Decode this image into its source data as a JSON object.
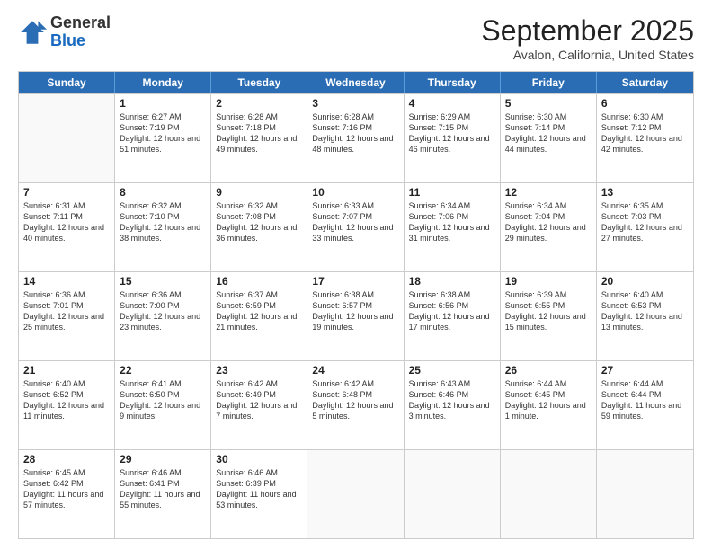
{
  "header": {
    "logo_general": "General",
    "logo_blue": "Blue",
    "month_title": "September 2025",
    "location": "Avalon, California, United States"
  },
  "weekdays": [
    "Sunday",
    "Monday",
    "Tuesday",
    "Wednesday",
    "Thursday",
    "Friday",
    "Saturday"
  ],
  "weeks": [
    [
      {
        "day": "",
        "empty": true
      },
      {
        "day": "1",
        "sunrise": "Sunrise: 6:27 AM",
        "sunset": "Sunset: 7:19 PM",
        "daylight": "Daylight: 12 hours and 51 minutes."
      },
      {
        "day": "2",
        "sunrise": "Sunrise: 6:28 AM",
        "sunset": "Sunset: 7:18 PM",
        "daylight": "Daylight: 12 hours and 49 minutes."
      },
      {
        "day": "3",
        "sunrise": "Sunrise: 6:28 AM",
        "sunset": "Sunset: 7:16 PM",
        "daylight": "Daylight: 12 hours and 48 minutes."
      },
      {
        "day": "4",
        "sunrise": "Sunrise: 6:29 AM",
        "sunset": "Sunset: 7:15 PM",
        "daylight": "Daylight: 12 hours and 46 minutes."
      },
      {
        "day": "5",
        "sunrise": "Sunrise: 6:30 AM",
        "sunset": "Sunset: 7:14 PM",
        "daylight": "Daylight: 12 hours and 44 minutes."
      },
      {
        "day": "6",
        "sunrise": "Sunrise: 6:30 AM",
        "sunset": "Sunset: 7:12 PM",
        "daylight": "Daylight: 12 hours and 42 minutes."
      }
    ],
    [
      {
        "day": "7",
        "sunrise": "Sunrise: 6:31 AM",
        "sunset": "Sunset: 7:11 PM",
        "daylight": "Daylight: 12 hours and 40 minutes."
      },
      {
        "day": "8",
        "sunrise": "Sunrise: 6:32 AM",
        "sunset": "Sunset: 7:10 PM",
        "daylight": "Daylight: 12 hours and 38 minutes."
      },
      {
        "day": "9",
        "sunrise": "Sunrise: 6:32 AM",
        "sunset": "Sunset: 7:08 PM",
        "daylight": "Daylight: 12 hours and 36 minutes."
      },
      {
        "day": "10",
        "sunrise": "Sunrise: 6:33 AM",
        "sunset": "Sunset: 7:07 PM",
        "daylight": "Daylight: 12 hours and 33 minutes."
      },
      {
        "day": "11",
        "sunrise": "Sunrise: 6:34 AM",
        "sunset": "Sunset: 7:06 PM",
        "daylight": "Daylight: 12 hours and 31 minutes."
      },
      {
        "day": "12",
        "sunrise": "Sunrise: 6:34 AM",
        "sunset": "Sunset: 7:04 PM",
        "daylight": "Daylight: 12 hours and 29 minutes."
      },
      {
        "day": "13",
        "sunrise": "Sunrise: 6:35 AM",
        "sunset": "Sunset: 7:03 PM",
        "daylight": "Daylight: 12 hours and 27 minutes."
      }
    ],
    [
      {
        "day": "14",
        "sunrise": "Sunrise: 6:36 AM",
        "sunset": "Sunset: 7:01 PM",
        "daylight": "Daylight: 12 hours and 25 minutes."
      },
      {
        "day": "15",
        "sunrise": "Sunrise: 6:36 AM",
        "sunset": "Sunset: 7:00 PM",
        "daylight": "Daylight: 12 hours and 23 minutes."
      },
      {
        "day": "16",
        "sunrise": "Sunrise: 6:37 AM",
        "sunset": "Sunset: 6:59 PM",
        "daylight": "Daylight: 12 hours and 21 minutes."
      },
      {
        "day": "17",
        "sunrise": "Sunrise: 6:38 AM",
        "sunset": "Sunset: 6:57 PM",
        "daylight": "Daylight: 12 hours and 19 minutes."
      },
      {
        "day": "18",
        "sunrise": "Sunrise: 6:38 AM",
        "sunset": "Sunset: 6:56 PM",
        "daylight": "Daylight: 12 hours and 17 minutes."
      },
      {
        "day": "19",
        "sunrise": "Sunrise: 6:39 AM",
        "sunset": "Sunset: 6:55 PM",
        "daylight": "Daylight: 12 hours and 15 minutes."
      },
      {
        "day": "20",
        "sunrise": "Sunrise: 6:40 AM",
        "sunset": "Sunset: 6:53 PM",
        "daylight": "Daylight: 12 hours and 13 minutes."
      }
    ],
    [
      {
        "day": "21",
        "sunrise": "Sunrise: 6:40 AM",
        "sunset": "Sunset: 6:52 PM",
        "daylight": "Daylight: 12 hours and 11 minutes."
      },
      {
        "day": "22",
        "sunrise": "Sunrise: 6:41 AM",
        "sunset": "Sunset: 6:50 PM",
        "daylight": "Daylight: 12 hours and 9 minutes."
      },
      {
        "day": "23",
        "sunrise": "Sunrise: 6:42 AM",
        "sunset": "Sunset: 6:49 PM",
        "daylight": "Daylight: 12 hours and 7 minutes."
      },
      {
        "day": "24",
        "sunrise": "Sunrise: 6:42 AM",
        "sunset": "Sunset: 6:48 PM",
        "daylight": "Daylight: 12 hours and 5 minutes."
      },
      {
        "day": "25",
        "sunrise": "Sunrise: 6:43 AM",
        "sunset": "Sunset: 6:46 PM",
        "daylight": "Daylight: 12 hours and 3 minutes."
      },
      {
        "day": "26",
        "sunrise": "Sunrise: 6:44 AM",
        "sunset": "Sunset: 6:45 PM",
        "daylight": "Daylight: 12 hours and 1 minute."
      },
      {
        "day": "27",
        "sunrise": "Sunrise: 6:44 AM",
        "sunset": "Sunset: 6:44 PM",
        "daylight": "Daylight: 11 hours and 59 minutes."
      }
    ],
    [
      {
        "day": "28",
        "sunrise": "Sunrise: 6:45 AM",
        "sunset": "Sunset: 6:42 PM",
        "daylight": "Daylight: 11 hours and 57 minutes."
      },
      {
        "day": "29",
        "sunrise": "Sunrise: 6:46 AM",
        "sunset": "Sunset: 6:41 PM",
        "daylight": "Daylight: 11 hours and 55 minutes."
      },
      {
        "day": "30",
        "sunrise": "Sunrise: 6:46 AM",
        "sunset": "Sunset: 6:39 PM",
        "daylight": "Daylight: 11 hours and 53 minutes."
      },
      {
        "day": "",
        "empty": true
      },
      {
        "day": "",
        "empty": true
      },
      {
        "day": "",
        "empty": true
      },
      {
        "day": "",
        "empty": true
      }
    ]
  ]
}
